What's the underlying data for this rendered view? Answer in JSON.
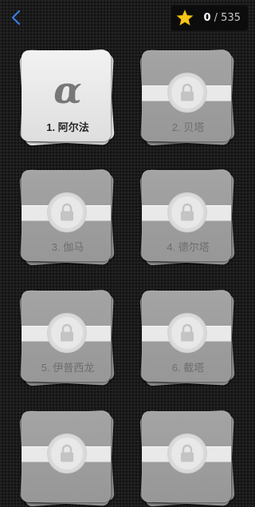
{
  "header": {
    "back_icon": "chevron-left-icon",
    "score": {
      "icon": "star-icon",
      "current": "0",
      "separator": " / ",
      "total": "535"
    }
  },
  "colors": {
    "accent_blue": "#3b7de0",
    "star_yellow": "#f5c518"
  },
  "levels": [
    {
      "label": "1. 阿尔法",
      "glyph": "α",
      "locked": false
    },
    {
      "label": "2. 贝塔",
      "locked": true
    },
    {
      "label": "3. 伽马",
      "locked": true
    },
    {
      "label": "4. 德尔塔",
      "locked": true
    },
    {
      "label": "5. 伊普西龙",
      "locked": true
    },
    {
      "label": "6. 截塔",
      "locked": true
    },
    {
      "label": "",
      "locked": true
    },
    {
      "label": "",
      "locked": true
    }
  ]
}
